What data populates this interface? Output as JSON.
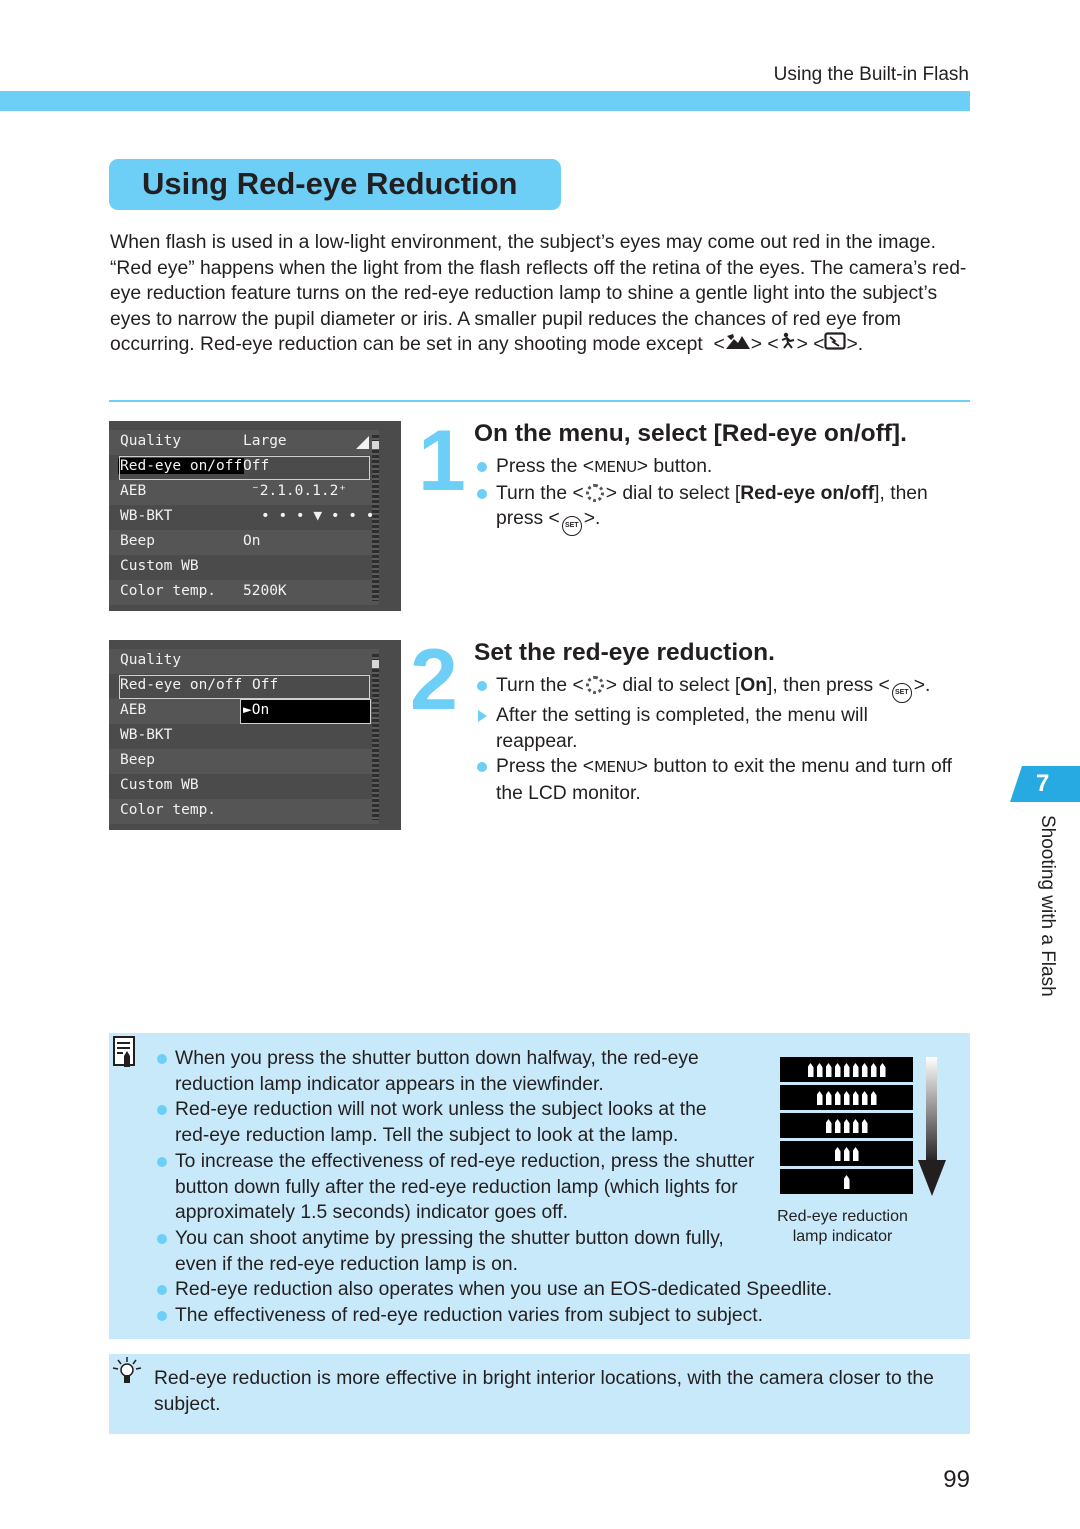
{
  "header": {
    "running_title": "Using the Built-in Flash"
  },
  "section": {
    "title": "Using Red-eye Reduction"
  },
  "intro": {
    "text": "When flash is used in a low-light environment, the subject’s eyes may come out red in the image. “Red eye” happens when the light from the flash reflects off the retina of the eyes. The camera’s red-eye reduction feature turns on the red-eye reduction lamp to shine a gentle light into the subject’s eyes to narrow the pupil diameter or iris. A smaller pupil reduces the chances of red eye from occurring. Red-eye reduction can be set in any shooting mode except",
    "lt": "<",
    "gt": ">",
    "period": ".",
    "excluded_modes": [
      "landscape-mode-icon",
      "sports-mode-icon",
      "flash-off-mode-icon"
    ]
  },
  "lcd1": {
    "rows": [
      {
        "key": "Quality",
        "value": "Large"
      },
      {
        "key": "Red-eye on/off",
        "value": "Off"
      },
      {
        "key": "AEB",
        "value": "⁻2.1.0.1.2⁺"
      },
      {
        "key": "WB-BKT",
        "value": "• • • ▼ • • •"
      },
      {
        "key": "Beep",
        "value": "On"
      },
      {
        "key": "Custom WB",
        "value": ""
      },
      {
        "key": "Color temp.",
        "value": "5200K"
      }
    ]
  },
  "lcd2": {
    "rows": [
      {
        "key": "Quality",
        "value": ""
      },
      {
        "key": "Red-eye on/off",
        "value": "Off"
      },
      {
        "key": "AEB",
        "value": ""
      },
      {
        "key": "WB-BKT",
        "value": ""
      },
      {
        "key": "Beep",
        "value": ""
      },
      {
        "key": "Custom WB",
        "value": ""
      },
      {
        "key": "Color temp.",
        "value": ""
      }
    ],
    "dropdown_option": "►On"
  },
  "step1": {
    "number": "1",
    "title": "On the menu, select [Red-eye on/off].",
    "b1_pre": "Press the <",
    "b1_kw": "MENU",
    "b1_post": "> button.",
    "b2_pre": "Turn the <",
    "b2_mid": "> dial to select [",
    "b2_bold": "Red-eye on/off",
    "b2_post": "], then press <",
    "b2_end": ">.",
    "set_label": "SET"
  },
  "step2": {
    "number": "2",
    "title": "Set the red-eye reduction.",
    "b1_pre": "Turn the <",
    "b1_mid": "> dial to select [",
    "b1_bold": "On",
    "b1_post": "], then press <",
    "b1_end": ">.",
    "b2": "After the setting is completed, the menu will reappear.",
    "b3_pre": "Press the <",
    "b3_kw": "MENU",
    "b3_post": "> button to exit the menu and turn off the LCD monitor.",
    "set_label": "SET"
  },
  "chapter": {
    "number": "7",
    "label": "Shooting with a Flash",
    "color": "#27aae1"
  },
  "notes": [
    "When you press the shutter button down halfway, the red-eye reduction lamp indicator appears in the viewfinder.",
    "Red-eye reduction will not work unless the subject looks at the red-eye reduction lamp. Tell the subject to look at the lamp.",
    "To increase the effectiveness of red-eye reduction, press the shutter button down fully  after the red-eye reduction lamp (which lights for approximately 1.5 seconds) indicator goes off.",
    "You can shoot anytime by pressing the shutter button down fully, even if the red-eye reduction lamp is on.",
    "Red-eye reduction also operates when you use an EOS-dedicated Speedlite.",
    "The effectiveness of red-eye reduction varies from subject to subject."
  ],
  "lamp_indicator": {
    "caption": "Red-eye reduction lamp indicator",
    "segments_per_row": [
      9,
      7,
      5,
      3,
      1
    ]
  },
  "tip": {
    "text": "Red-eye reduction is more effective in bright interior locations, with the camera closer to the subject."
  },
  "footer": {
    "page_number": "99"
  },
  "colors": {
    "accent": "#6dcff6",
    "note_bg": "#c7e9fa",
    "text": "#231f20"
  }
}
